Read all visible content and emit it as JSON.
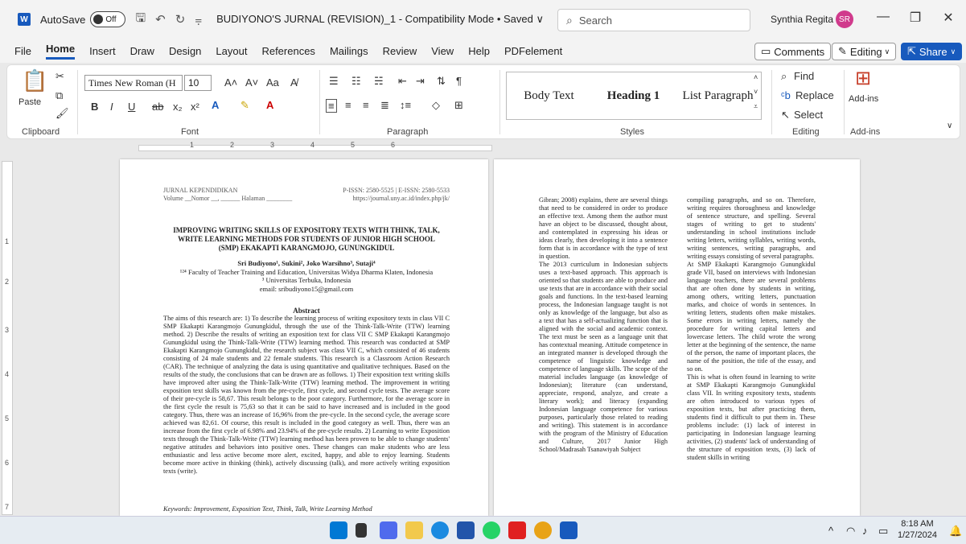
{
  "titlebar": {
    "app_letter": "W",
    "autosave_label": "AutoSave",
    "autosave_state": "Off",
    "doc_title": "BUDIYONO'S JURNAL (REVISION)_1  -  Compatibility Mode • Saved ∨",
    "search_placeholder": "Search",
    "user_name": "Synthia Regita",
    "user_initials": "SR"
  },
  "menu": {
    "items": [
      "File",
      "Home",
      "Insert",
      "Draw",
      "Design",
      "Layout",
      "References",
      "Mailings",
      "Review",
      "View",
      "Help",
      "PDFelement"
    ],
    "comments_label": "Comments",
    "editing_label": "Editing",
    "share_label": "Share"
  },
  "ribbon": {
    "paste_label": "Paste",
    "font_name": "Times New Roman (H",
    "font_size": "10",
    "styles": [
      "Body Text",
      "Heading 1",
      "List Paragraph"
    ],
    "find_label": "Find",
    "replace_label": "Replace",
    "select_label": "Select",
    "addins_label": "Add-ins",
    "groups": [
      "Clipboard",
      "Font",
      "Paragraph",
      "Styles",
      "Editing",
      "Add-ins"
    ]
  },
  "ruler": {
    "numbers": [
      "1",
      "2",
      "3",
      "4",
      "5",
      "6"
    ]
  },
  "vruler": {
    "numbers": [
      "1",
      "2",
      "3",
      "4",
      "5",
      "6",
      "7"
    ]
  },
  "page1": {
    "journal": "JURNAL KEPENDIDIKAN",
    "volume_line": "Volume __Nomor __, ______ Halaman ________",
    "issn": "P-ISSN: 2580-5525 | E-ISSN: 2580-5533",
    "url": "https://journal.uny.ac.id/index.php/jk/",
    "title_line1": "IMPROVING WRITING SKILLS OF EXPOSITORY TEXTS WITH THINK, TALK,",
    "title_line2": "WRITE LEARNING METHODS FOR STUDENTS OF JUNIOR HIGH SCHOOL",
    "title_line3": "(SMP) EKAKAPTI KARANGMOJO, GUNUNGKIDUL",
    "authors": "Sri Budiyono¹, Sukini², Joko Warsihno³, Sutaji⁴",
    "affiliation1": "¹²⁴ Faculty of Teacher Training and Education, Universitas Widya Dharma Klaten, Indonesia",
    "affiliation2": "³ Universitas Terbuka, Indonesia",
    "email": "email: sribudiyono15@gmail.com",
    "abstract_heading": "Abstract",
    "abstract": "The aims of this research are: 1) To describe the learning process of writing expository texts in class VII C SMP Ekakapti Karangmojo Gunungkidul, through the use of the Think-Talk-Write (TTW) learning method. 2) Describe the results of writing an exposition text for class VII C SMP Ekakapti Karangmojo Gunungkidul using the Think-Talk-Write (TTW) learning method. This research was conducted at SMP Ekakapti Karangmojo Gunungkidul, the research subject was class VII C, which consisted of 46 students consisting of 24 male students and 22 female students. This research is a Classroom Action Research (CAR). The technique of analyzing the data is using quantitative and qualitative techniques. Based on the results of the study, the conclusions that can be drawn are as follows. 1) Their exposition text writing skills have improved after using the Think-Talk-Write (TTW) learning method. The improvement in writing exposition text skills was known from the pre-cycle, first cycle, and second cycle tests. The average score of their pre-cycle is 58,67. This result belongs to the poor category. Furthermore, for the average score in the first cycle the result is 75,63 so that it can be said to have increased and is included in the good category. Thus, there was an increase of 16,96% from the pre-cycle. In the second cycle, the average score achieved was 82,61. Of course, this result is included in the good category as well. Thus, there was an increase from the first cycle of 6.98% and 23.94% of the pre-cycle results. 2) Learning to write Exposition texts through the Think-Talk-Write (TTW) learning method has been proven to be able to change students' negative attitudes and behaviors into positive ones. These changes can make students who are less enthusiastic and less active become more alert, excited, happy, and able to enjoy learning. Students become more active in thinking (think), actively discussing (talk), and more actively writing exposition texts (write).",
    "keywords": "Keywords: Improvement, Exposition Text, Think, Talk, Write Learning Method"
  },
  "page2": {
    "col1": "Gibran; 2008) explains, there are several things that need to be considered in order to produce an effective text. Among them the author must have an object to be discussed, thought about, and contemplated in expressing his ideas or ideas clearly, then developing it into a sentence form that is in accordance with the type of text in question.\n      The 2013 curriculum in Indonesian subjects uses a text-based approach. This approach is oriented so that students are able to produce and use texts that are in accordance with their social goals and functions. In the text-based learning process, the Indonesian language taught is not only as knowledge of the language, but also as a text that has a self-actualizing function that is aligned with the social and academic context. The text must be seen as a language unit that has contextual meaning. Attitude competence in an integrated manner is developed through the competence of linguistic knowledge and competence of language skills. The scope of the material includes language (as knowledge of Indonesian); literature (can understand, appreciate, respond, analyze, and create a literary work); and literacy (expanding Indonesian language competence for various purposes, particularly those related to reading and writing). This statement is in accordance with the program of the Ministry of Education and Culture, 2017 Junior High School/Madrasah Tsanawiyah Subject",
    "col2": "compiling paragraphs, and so on. Therefore, writing requires thoroughness and knowledge of sentence structure, and spelling. Several stages of writing to get to students' understanding in school institutions include writing letters, writing syllables, writing words, writing sentences, writing paragraphs, and writing essays consisting of several paragraphs.\n      At SMP Ekakapti Karangmojo Gunungkidul grade VII, based on interviews with Indonesian language teachers, there are several problems that are often done by students in writing, among others, writing letters, punctuation marks, and choice of words in sentences. In writing letters, students often make mistakes. Some errors in writing letters, namely the procedure for writing capital letters and lowercase letters. The child wrote the wrong letter at the beginning of the sentence, the name of the person, the name of important places, the name of the position, the title of the essay, and so on.\n      This is what is often found in learning to write at SMP Ekakapti Karangmojo Gunungkidul class VII. In writing expository texts, students are often introduced to various types of exposition texts, but after practicing them, students find it difficult to put them in. These problems include: (1) lack of interest in participating in Indonesian language learning activities, (2) students' lack of understanding of the structure of exposition texts, (3) lack of student skills in writing"
  },
  "taskbar": {
    "time": "8:18 AM",
    "date": "1/27/2024"
  },
  "colors": {
    "accent": "#185abd",
    "avatar": "#d03a8c"
  }
}
